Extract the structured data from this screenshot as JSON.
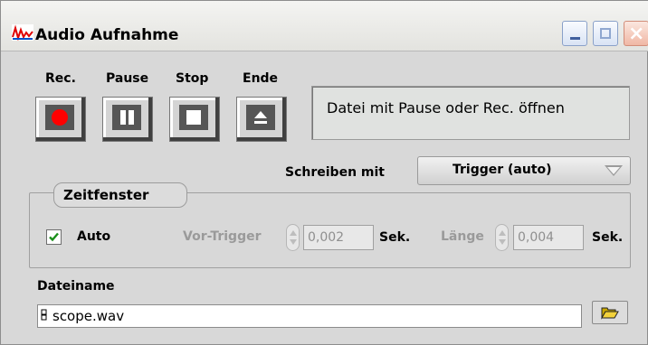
{
  "window": {
    "title": "Audio Aufnahme"
  },
  "transport": {
    "rec_label": "Rec.",
    "pause_label": "Pause",
    "stop_label": "Stop",
    "end_label": "Ende"
  },
  "status": {
    "message": "Datei mit Pause oder  Rec. öffnen"
  },
  "write_mode": {
    "label": "Schreiben mit",
    "value": "Trigger (auto)"
  },
  "time_window": {
    "title": "Zeitfenster",
    "auto_label": "Auto",
    "auto_checked": true,
    "pre_trigger_label": "Vor-Trigger",
    "pre_trigger_value": "0,002",
    "pre_trigger_unit": "Sek.",
    "length_label": "Länge",
    "length_value": "0,004",
    "length_unit": "Sek."
  },
  "file": {
    "label": "Dateiname",
    "value": "scope.wav"
  },
  "colors": {
    "rec": "#ff0000",
    "button_face": "#565656",
    "panel": "#d8d8d8"
  }
}
